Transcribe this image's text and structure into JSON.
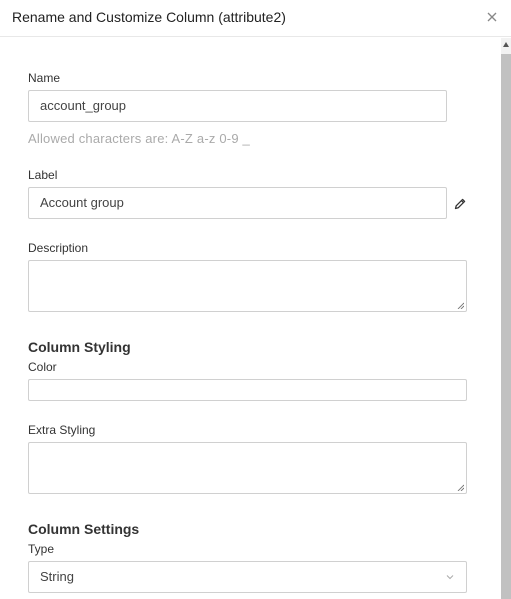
{
  "dialog": {
    "title": "Rename and Customize Column (attribute2)",
    "close_icon": "close-icon"
  },
  "name": {
    "label": "Name",
    "value": "account_group",
    "hint": "Allowed characters are: A-Z a-z 0-9 _"
  },
  "label_field": {
    "label": "Label",
    "value": "Account group",
    "edit_icon": "pencil-icon"
  },
  "description": {
    "label": "Description",
    "value": ""
  },
  "column_styling": {
    "title": "Column Styling",
    "color_label": "Color",
    "color_value": "",
    "extra_styling_label": "Extra Styling",
    "extra_styling_value": ""
  },
  "column_settings": {
    "title": "Column Settings",
    "type_label": "Type",
    "type_value": "String"
  }
}
